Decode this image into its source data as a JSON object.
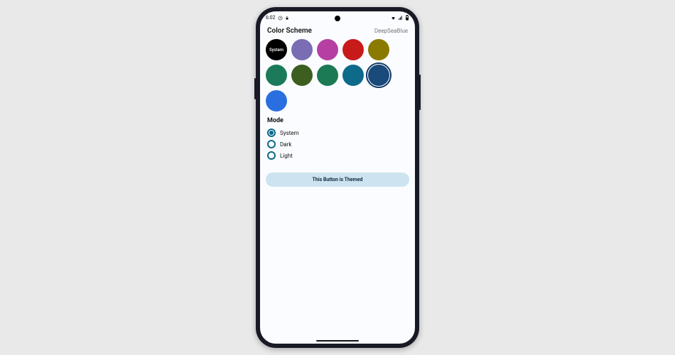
{
  "statusbar": {
    "time": "6:02"
  },
  "header": {
    "title": "Color Scheme",
    "current_scheme": "DeepSeaBlue"
  },
  "swatches": [
    {
      "id": "system",
      "label": "System",
      "color": "#000000",
      "is_system": true,
      "selected": false
    },
    {
      "id": "purple",
      "color": "#7a6db3",
      "selected": false
    },
    {
      "id": "magenta",
      "color": "#b63fa4",
      "selected": false
    },
    {
      "id": "red",
      "color": "#c81a1a",
      "selected": false
    },
    {
      "id": "olive",
      "color": "#8a7a00",
      "selected": false
    },
    {
      "id": "teal",
      "color": "#1b7a5a",
      "selected": false
    },
    {
      "id": "darkgreen",
      "color": "#3c5f1f",
      "selected": false
    },
    {
      "id": "emerald",
      "color": "#1c7a55",
      "selected": false
    },
    {
      "id": "deepsea",
      "color": "#0d6a8a",
      "selected": false
    },
    {
      "id": "navy",
      "color": "#1a4a7a",
      "selected": true
    },
    {
      "id": "blue",
      "color": "#2a6fe0",
      "selected": false
    }
  ],
  "mode": {
    "title": "Mode",
    "options": [
      {
        "id": "system",
        "label": "System",
        "checked": true
      },
      {
        "id": "dark",
        "label": "Dark",
        "checked": false
      },
      {
        "id": "light",
        "label": "Light",
        "checked": false
      }
    ]
  },
  "themed_button": {
    "label": "This Button is Themed"
  }
}
